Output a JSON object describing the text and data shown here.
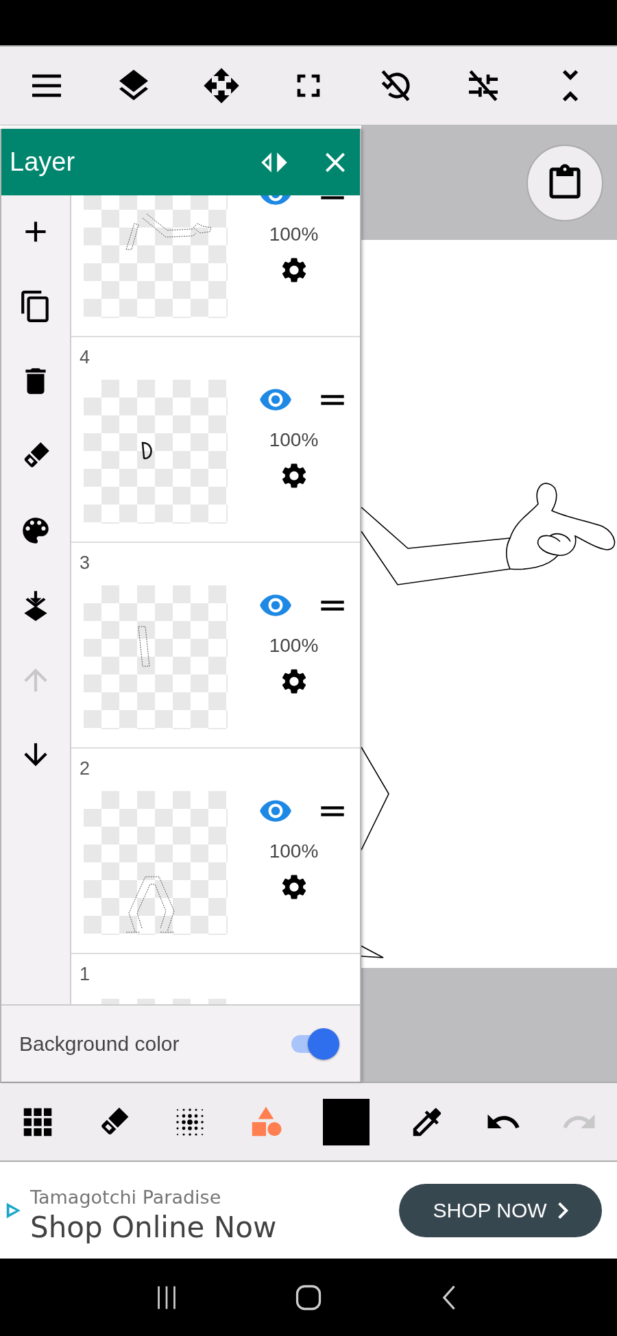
{
  "layer_panel": {
    "title": "Layer",
    "sidebar_actions": [
      {
        "kind": "add",
        "disabled": false
      },
      {
        "kind": "duplicate",
        "disabled": false
      },
      {
        "kind": "delete",
        "disabled": false
      },
      {
        "kind": "eraser",
        "disabled": false
      },
      {
        "kind": "palette",
        "disabled": false
      },
      {
        "kind": "merge_down",
        "disabled": false
      },
      {
        "kind": "move_up",
        "disabled": true
      },
      {
        "kind": "move_down",
        "disabled": false
      }
    ],
    "layers": [
      {
        "kind": "cut_top",
        "visible": true,
        "opacity": "100%"
      },
      {
        "kind": "full",
        "number": "4",
        "visible": true,
        "opacity": "100%"
      },
      {
        "kind": "full",
        "number": "3",
        "visible": true,
        "opacity": "100%"
      },
      {
        "kind": "full",
        "number": "2",
        "visible": true,
        "opacity": "100%"
      },
      {
        "kind": "cut_bottom",
        "number": "1"
      }
    ],
    "background_color": {
      "label": "Background color",
      "on": true
    }
  },
  "bottom_toolbar": [
    {
      "kind": "grid",
      "selected": false
    },
    {
      "kind": "eraser",
      "selected": false
    },
    {
      "kind": "halftone",
      "selected": false
    },
    {
      "kind": "shapes",
      "selected": true
    },
    {
      "kind": "color"
    },
    {
      "kind": "eyedropper",
      "selected": false
    },
    {
      "kind": "undo",
      "disabled": false
    },
    {
      "kind": "redo",
      "disabled": true
    }
  ],
  "ad": {
    "brand": "Tamagotchi Paradise",
    "headline": "Shop Online Now",
    "button": "SHOP NOW"
  }
}
